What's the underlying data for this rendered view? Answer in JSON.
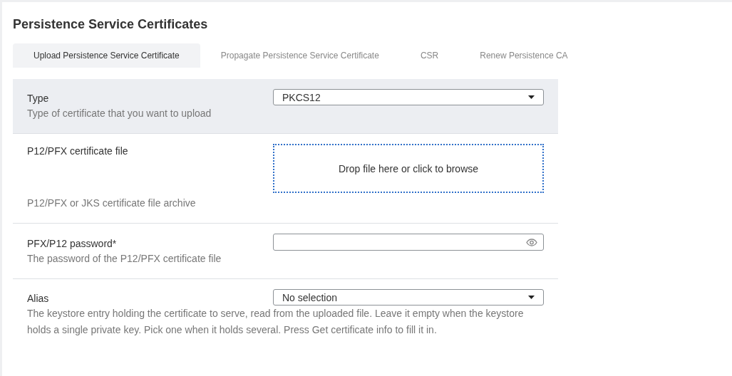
{
  "title": "Persistence Service Certificates",
  "tabs": [
    {
      "label": "Upload Persistence Service Certificate",
      "selected": true
    },
    {
      "label": "Propagate Persistence Service Certificate",
      "selected": false
    },
    {
      "label": "CSR",
      "selected": false
    },
    {
      "label": "Renew Persistence CA",
      "selected": false
    }
  ],
  "fields": [
    {
      "kind": "select",
      "label": "Type",
      "description": "Type of certificate that you want to upload",
      "value": "PKCS12",
      "highlighted": true
    },
    {
      "kind": "dropzone",
      "label": "P12/PFX certificate file",
      "description": "P12/PFX or JKS certificate file archive",
      "prompt": "Drop file here or click to browse",
      "highlighted": false
    },
    {
      "kind": "password",
      "label": "PFX/P12 password*",
      "description": "The password of the P12/PFX certificate file",
      "highlighted": false
    },
    {
      "kind": "select-wide",
      "label": "Alias",
      "description": "The keystore entry holding the certificate to serve, read from the uploaded file. Leave it empty when the keystore holds a single private key. Pick one when it holds several. Press Get certificate info to fill it in.",
      "value": "No selection",
      "highlighted": false
    }
  ]
}
